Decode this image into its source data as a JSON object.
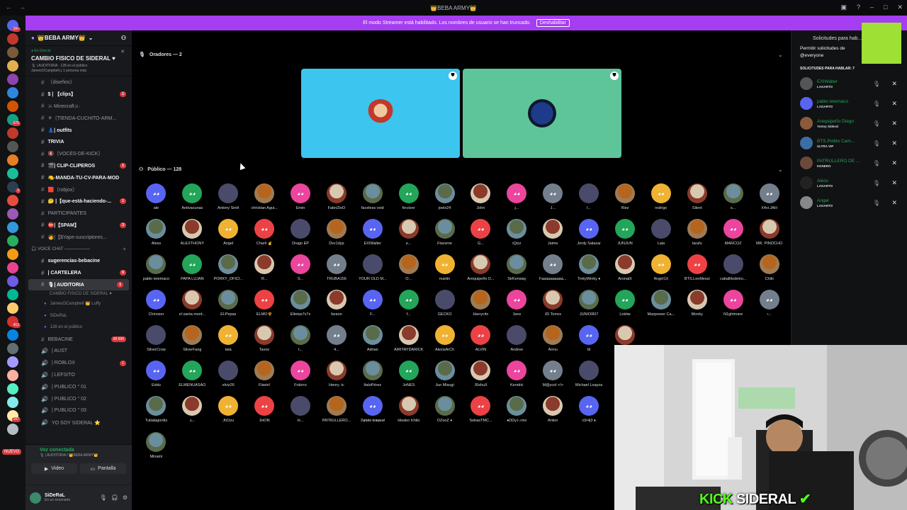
{
  "titlebar": {
    "title": "👑BEBA ARMY👑"
  },
  "banner": {
    "text": "El modo Streamer está habilitado. Los nombres de usuario se han truncado.",
    "button": "Deshabilitar"
  },
  "servers": {
    "badges": [
      "18+",
      "",
      "",
      "",
      "",
      "",
      "",
      "676",
      "",
      "",
      "",
      "",
      "3",
      "",
      "",
      "",
      "",
      "",
      "",
      "",
      "",
      "",
      "412",
      "",
      "",
      "",
      "",
      "",
      "",
      "167",
      "",
      "",
      ""
    ],
    "new_label": "NUEVO"
  },
  "guild": {
    "name": "👑BEBA ARMY👑"
  },
  "live": {
    "label": "● En Directo",
    "title": "CAMBIO FISICO DE SIDERAL ♥",
    "sub1": "🎙 | AUDITORIA · 128 en el público",
    "sub2": "JamesOCampbell y 1 persona más"
  },
  "channels": [
    {
      "t": "〔diseños〕",
      "s": "#",
      "b": false,
      "n": ""
    },
    {
      "t": "$ | 【clips】",
      "s": "#",
      "b": true,
      "n": "1"
    },
    {
      "t": "⚔·Minecraft⚔·",
      "s": "#",
      "b": false,
      "n": ""
    },
    {
      "t": "⚜〔TIENDA-CUCHITO-ARM...",
      "s": "#",
      "b": false,
      "n": ""
    },
    {
      "t": "👗| outfits",
      "s": "#",
      "b": true,
      "n": ""
    },
    {
      "t": "TRIVIA",
      "s": "#",
      "b": true,
      "n": ""
    },
    {
      "t": "🔇〔VOCES-DE-KICK〕",
      "s": "#",
      "b": false,
      "n": ""
    },
    {
      "t": "🎬| CLIP-CLIPEROS",
      "s": "#",
      "b": true,
      "n": "1"
    },
    {
      "t": "🍋-MANDA-TU-CV-PARA-MOD",
      "s": "#",
      "b": true,
      "n": ""
    },
    {
      "t": "🟥〔robjox〕",
      "s": "#",
      "b": false,
      "n": ""
    },
    {
      "t": "🤔 |【que-está-haciendo-...",
      "s": "#",
      "b": true,
      "n": "1"
    },
    {
      "t": "PARTICIPANTES",
      "s": "#",
      "b": false,
      "n": ""
    },
    {
      "t": "⛔|【SPAM】",
      "s": "#",
      "b": true,
      "n": "3"
    },
    {
      "t": "🧑|【$Yape-suscriptores...",
      "s": "#",
      "b": false,
      "n": ""
    }
  ],
  "voice_cat": "🎧 VOICE CHAT ——————",
  "channels2": [
    {
      "t": "sugerencias-bebacine",
      "s": "#",
      "b": true,
      "n": ""
    },
    {
      "t": "| CARTELERA",
      "s": "#",
      "b": true,
      "n": "6"
    },
    {
      "t": "🎙| AUDITORIA",
      "s": "#",
      "b": true,
      "n": "1"
    }
  ],
  "auditoria_sub": "CAMBIO FISICO DE SIDERAL ♥",
  "auditoria_members": [
    "JamesOCampbell 👑 Luffy",
    "SiDeRaL",
    "128 en el público"
  ],
  "channels3": [
    {
      "t": "BEBACINE",
      "s": "#",
      "b": false,
      "n": "00 690"
    },
    {
      "t": "| AUST",
      "s": "🔊",
      "b": false,
      "n": ""
    },
    {
      "t": "| ROBLOX",
      "s": "🔊",
      "b": false,
      "n": "1"
    },
    {
      "t": "| LEFSITO",
      "s": "🔊",
      "b": false,
      "n": ""
    },
    {
      "t": "| PUBLICO ° 01",
      "s": "🔊",
      "b": false,
      "n": ""
    },
    {
      "t": "| PUBLICO ° 02",
      "s": "🔊",
      "b": false,
      "n": ""
    },
    {
      "t": "| PUBLICO ° 03",
      "s": "🔊",
      "b": false,
      "n": ""
    },
    {
      "t": "YO SOY SIDERAL ⭐",
      "s": "🔊",
      "b": false,
      "n": ""
    }
  ],
  "voicepanel": {
    "connected": "Voz conectada",
    "where": "🎙 | AUDITORIA / 👑BEBA ARMY👑",
    "video": "Video",
    "screen": "Pantalla"
  },
  "user": {
    "name": "SiDeRaL",
    "status": "En un escenario"
  },
  "stage": {
    "speakers_header": "Oradores — 2",
    "audience_header": "Público — 128"
  },
  "audience": [
    "ale",
    "Antivacunas",
    "Antony SinH",
    "christian Agui...",
    "Emin",
    "FabriZioO",
    "faceless void",
    "ferzizer",
    "joelx24",
    "John",
    "j...",
    "J...",
    "l...",
    "Riez",
    "rodrigo",
    "Silent",
    "s...",
    "X4vi.JAH",
    "Aless",
    "ALEXTHONY",
    "Angel",
    "Charli ✌",
    "Drago EP",
    "Dxv1dyp",
    "EXIWalter",
    "e...",
    "Flavsme",
    "G...",
    "iQizz",
    "Jaime",
    "Jordy Salazar",
    "JUNJUN",
    "Laia",
    "larafu",
    "MARCOZ",
    "MR. PINOCHO",
    "pablo telemaco",
    "PAPA LUJAN",
    "PORKY_OFICI...",
    "R...",
    "S...",
    "TRUBA156",
    "YOUR OLD M...",
    "O...",
    "martin",
    "Arequipeño D...",
    "SirKenway",
    "Faaaaaaaaaa...",
    "TinkyWinky ♦",
    "AronaiX",
    "Angel1X",
    "BTS.LeoMessi",
    "caballitodetro...",
    "Chiki",
    "Chinosor",
    "el santa mont...",
    "El-Pepas",
    "ELMO🌻",
    "Eltetas7v7x",
    "faraon",
    "F...",
    "f...",
    "GECKO",
    "Harrycito",
    "Jans",
    "JD Torres",
    "JUNIOR07",
    "Lokiiw",
    "Maxpower Ca...",
    "Monky",
    "N1ghtmare",
    "r...",
    "SilverCrow",
    "SilverFang",
    "tala",
    "Tavoo",
    "t...",
    "4...",
    "Adrian",
    "AIRITAYDARICK",
    "AlexisArCh",
    "ALVIN",
    "Andree",
    "Armu",
    "bl",
    "Bo...",
    "",
    "",
    "",
    "",
    "Eddu",
    "ELMENUASAO",
    "elviz26",
    "Flavio!",
    "Frdzrro",
    "Henry. tc",
    "ItaloPérez",
    "JoNES",
    "Jun Misugi",
    "J0shuX",
    "Kendric",
    "M@ycol </>",
    "Michael Loayza",
    "",
    "",
    "",
    "",
    "",
    "Tutialagordis",
    "u...",
    "JhOzu",
    "JHON",
    "H...",
    "PATRULLERO...",
    "𝕾𝖕𝖎𝖓𝖙𝖆 𝖙𝖊𝖒𝖕𝖊𝖘𝖙",
    "Hisako Ichiki",
    "DZooZ ♦",
    "SebasTMC...",
    "♦DDy.i-♪me",
    "Anton",
    "c0r4j3 ♦",
    "PR...",
    "",
    "",
    "",
    "",
    "Minami"
  ],
  "requests": {
    "title": "Solicitudes para hab...",
    "permit": "Permitir solicitudes de @everyone",
    "list_header": "SOLICITUDES PARA HABLAR: 7",
    "items": [
      {
        "name": "EXIWalter",
        "role": "LAGARTO",
        "color": "#23a55a"
      },
      {
        "name": "pablo telemaco",
        "role": "LAGARTO",
        "color": "#23a55a"
      },
      {
        "name": "Arequipeño Diego",
        "role": "YoSoy Sideral",
        "color": "#23a55a"
      },
      {
        "name": "BTS.Pollito Cam...",
        "role": "ULTRA VIP",
        "color": "#23a55a"
      },
      {
        "name": "PATRULLERO DE ...",
        "role": "KKNERO",
        "color": "#23a55a"
      },
      {
        "name": "Aless",
        "role": "LAGARTO",
        "color": "#23a55a"
      },
      {
        "name": "Angel",
        "role": "LAGARTO",
        "color": "#23a55a"
      }
    ]
  },
  "overlay": {
    "kick": "KICK",
    "name": "SIDERAL"
  }
}
